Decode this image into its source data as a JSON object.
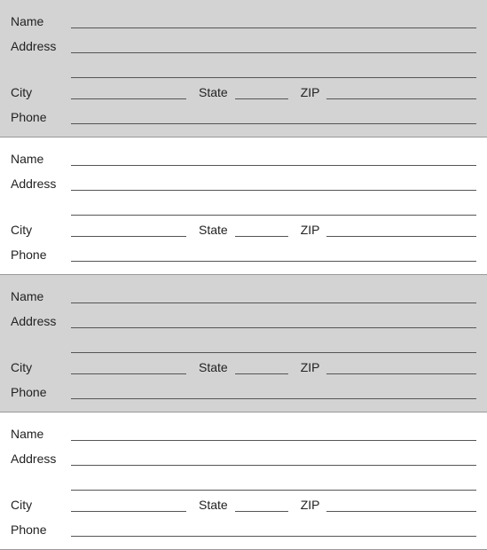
{
  "sections": [
    {
      "id": "section-1",
      "shaded": true,
      "labels": {
        "name": "Name",
        "address": "Address",
        "city": "City",
        "state": "State",
        "zip": "ZIP",
        "phone": "Phone"
      }
    },
    {
      "id": "section-2",
      "shaded": false,
      "labels": {
        "name": "Name",
        "address": "Address",
        "city": "City",
        "state": "State",
        "zip": "ZIP",
        "phone": "Phone"
      }
    },
    {
      "id": "section-3",
      "shaded": true,
      "labels": {
        "name": "Name",
        "address": "Address",
        "city": "City",
        "state": "State",
        "zip": "ZIP",
        "phone": "Phone"
      }
    },
    {
      "id": "section-4",
      "shaded": false,
      "labels": {
        "name": "Name",
        "address": "Address",
        "city": "City",
        "state": "State",
        "zip": "ZIP",
        "phone": "Phone"
      }
    }
  ]
}
